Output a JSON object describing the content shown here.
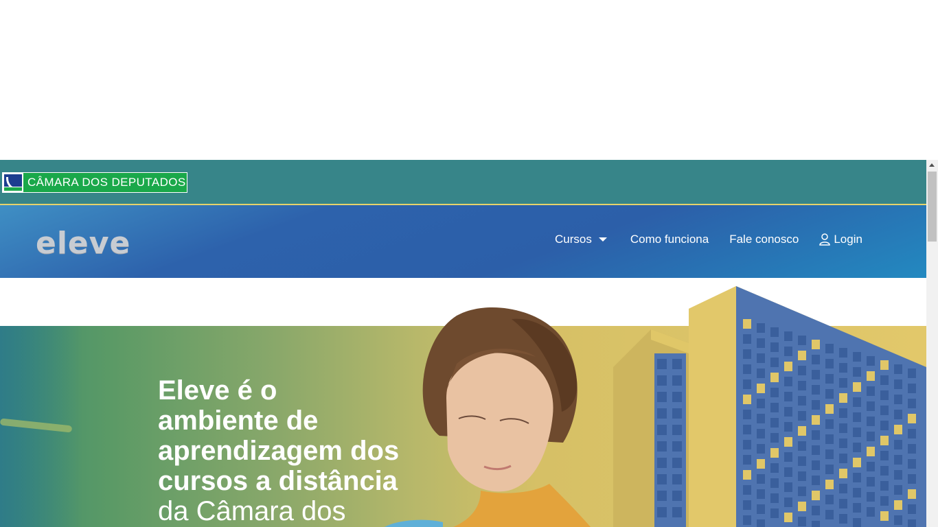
{
  "gov_bar": {
    "name": "CÂMARA DOS DEPUTADOS"
  },
  "header": {
    "logo_text": "eleve",
    "nav": {
      "cursos": "Cursos",
      "como_funciona": "Como funciona",
      "fale_conosco": "Fale conosco",
      "login": "Login"
    }
  },
  "hero": {
    "title_lines": [
      "Eleve é o",
      "ambiente de",
      "aprendizagem dos",
      "cursos a distância",
      "da Câmara dos"
    ]
  },
  "colors": {
    "gov_bar": "#378589",
    "gov_logo_green": "#1aa84a",
    "nav_blue": "#2c5fa9",
    "accent_yellow": "#e6d36a"
  },
  "icons": {
    "cursos_caret": "chevron-down-icon",
    "login": "user-icon"
  }
}
